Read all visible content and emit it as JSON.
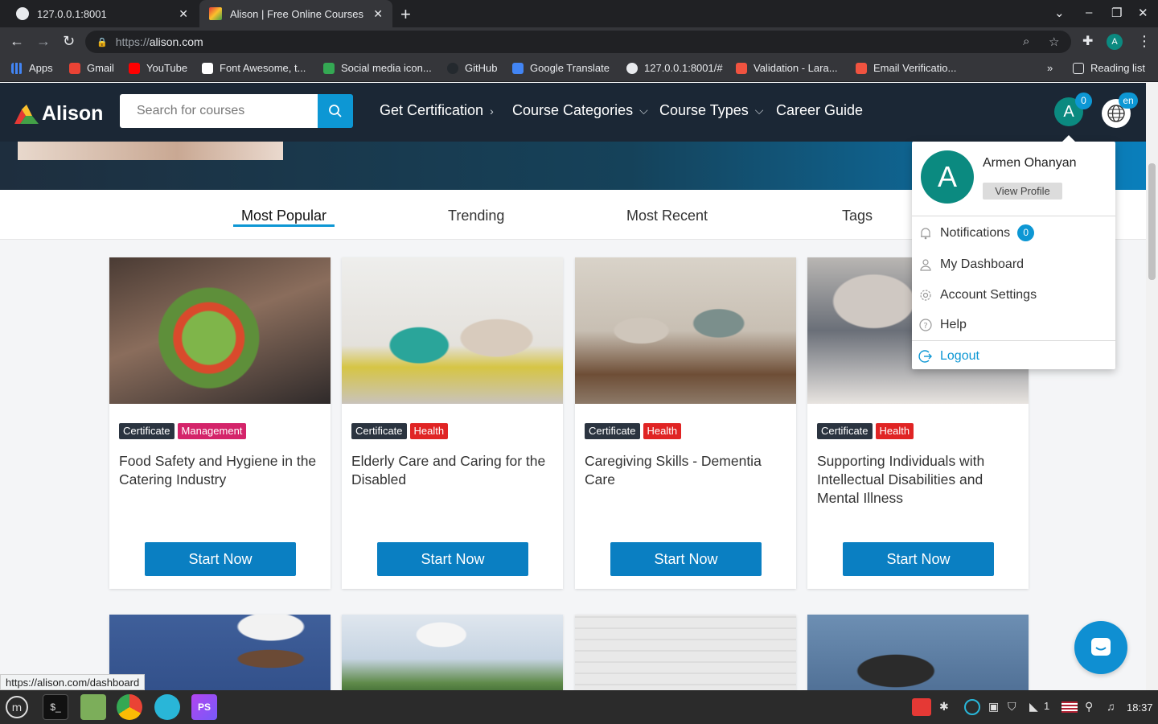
{
  "browser": {
    "tabs": [
      {
        "title": "127.0.0.1:8001",
        "active": false
      },
      {
        "title": "Alison | Free Online Courses &",
        "active": true
      }
    ],
    "url_scheme": "https://",
    "url_host": "alison.com",
    "profile_initial": "A",
    "bookmarks": [
      "Apps",
      "Gmail",
      "YouTube",
      "Font Awesome, t...",
      "Social media icon...",
      "GitHub",
      "Google Translate",
      "127.0.0.1:8001/#",
      "Validation - Lara...",
      "Email Verificatio..."
    ],
    "reading_list": "Reading list",
    "more": "»"
  },
  "site": {
    "logo": "Alison",
    "search_placeholder": "Search for courses",
    "nav": [
      "Get Certification",
      "Course Categories",
      "Course Types",
      "Career Guide"
    ],
    "avatar_initial": "A",
    "notif_count": "0",
    "language": "en"
  },
  "course_tabs": [
    "Most Popular",
    "Trending",
    "Most Recent",
    "Tags"
  ],
  "courses": [
    {
      "type": "Certificate",
      "category": "Management",
      "category_color": "#d4246a",
      "title": "Food Safety and Hygiene in the Catering Industry",
      "cta": "Start Now"
    },
    {
      "type": "Certificate",
      "category": "Health",
      "category_color": "#e02424",
      "title": "Elderly Care and Caring for the Disabled",
      "cta": "Start Now"
    },
    {
      "type": "Certificate",
      "category": "Health",
      "category_color": "#e02424",
      "title": "Caregiving Skills - Dementia Care",
      "cta": "Start Now"
    },
    {
      "type": "Certificate",
      "category": "Health",
      "category_color": "#e02424",
      "title": "Supporting Individuals with Intellectual Disabilities and Mental Illness",
      "cta": "Start Now"
    }
  ],
  "user_menu": {
    "avatar_initial": "A",
    "name": "Armen Ohanyan",
    "view_profile": "View Profile",
    "items": [
      {
        "label": "Notifications",
        "badge": "0"
      },
      {
        "label": "My Dashboard"
      },
      {
        "label": "Account Settings"
      },
      {
        "label": "Help"
      }
    ],
    "logout": "Logout"
  },
  "status_url": "https://alison.com/dashboard",
  "taskbar": {
    "tray_count": "1",
    "clock": "18:37"
  },
  "colors": {
    "nav_bg": "#1b2735",
    "accent": "#0d97d4",
    "button": "#0a7fc2",
    "avatar": "#0b8a80"
  }
}
